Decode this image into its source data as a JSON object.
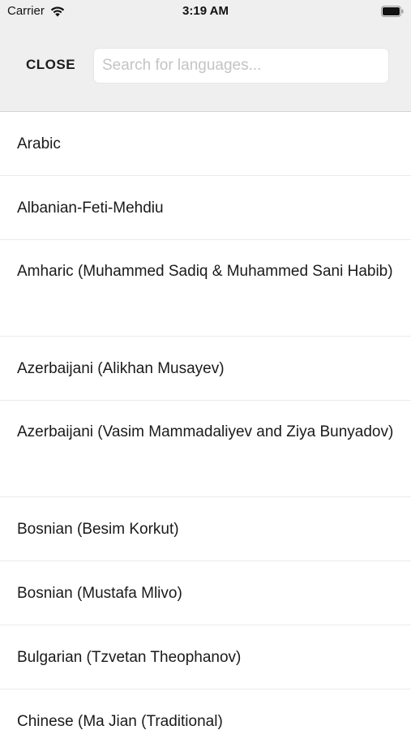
{
  "status_bar": {
    "carrier": "Carrier",
    "time": "3:19 AM",
    "wifi_icon": "wifi-icon",
    "battery_icon": "battery-icon"
  },
  "header": {
    "close_label": "CLOSE",
    "search_placeholder": "Search for languages...",
    "search_value": ""
  },
  "languages": [
    "Arabic",
    "Albanian-Feti-Mehdiu",
    "Amharic (Muhammed Sadiq & Muhammed Sani Habib)",
    "Azerbaijani (Alikhan Musayev)",
    "Azerbaijani (Vasim Mammadaliyev and Ziya Bunyadov)",
    "Bosnian (Besim Korkut)",
    "Bosnian (Mustafa Mlivo)",
    "Bulgarian (Tzvetan Theophanov)",
    "Chinese (Ma Jian (Traditional)"
  ],
  "colors": {
    "header_background": "#efefef",
    "text": "#1a1a1a",
    "placeholder": "#c4c4c6",
    "separator": "#ebebeb"
  }
}
